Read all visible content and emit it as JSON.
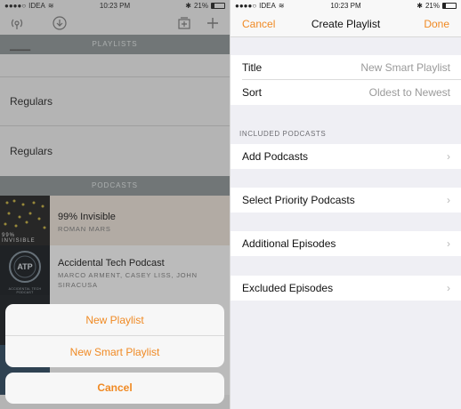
{
  "left_screen": {
    "status": {
      "carrier": "IDEA",
      "time": "10:23 PM",
      "battery": "21%"
    },
    "toolbar_icons": [
      "broadcast-icon",
      "download-icon",
      "playlist-add-icon",
      "add-icon"
    ],
    "playlists_header": "PLAYLISTS",
    "playlist_rows": [
      {
        "label": "Regulars"
      },
      {
        "label": "Regulars"
      }
    ],
    "podcasts_header": "PODCASTS",
    "podcasts": [
      {
        "title": "99% Invisible",
        "author": "ROMAN MARS",
        "art_text": "99% INVISIBLE"
      },
      {
        "title": "Accidental Tech Podcast",
        "author": "MARCO ARMENT, CASEY LISS, JOHN SIRACUSA",
        "art_text": "ATP",
        "art_caption": "ACCIDENTAL TECH PODCAST"
      }
    ],
    "action_sheet": {
      "new_playlist": "New Playlist",
      "new_smart_playlist": "New Smart Playlist",
      "cancel": "Cancel"
    }
  },
  "right_screen": {
    "status": {
      "carrier": "IDEA",
      "time": "10:23 PM",
      "battery": "21%"
    },
    "nav": {
      "cancel": "Cancel",
      "title": "Create Playlist",
      "done": "Done"
    },
    "title_row": {
      "label": "Title",
      "placeholder": "New Smart Playlist"
    },
    "sort_row": {
      "label": "Sort",
      "value": "Oldest to Newest"
    },
    "included_header": "INCLUDED PODCASTS",
    "add_podcasts": "Add Podcasts",
    "select_priority": "Select Priority Podcasts",
    "additional_episodes": "Additional Episodes",
    "excluded_episodes": "Excluded Episodes",
    "chevron": "›"
  },
  "colors": {
    "accent": "#f08a24",
    "section_header": "#8e9697",
    "grouped_bg": "#efeff4"
  }
}
